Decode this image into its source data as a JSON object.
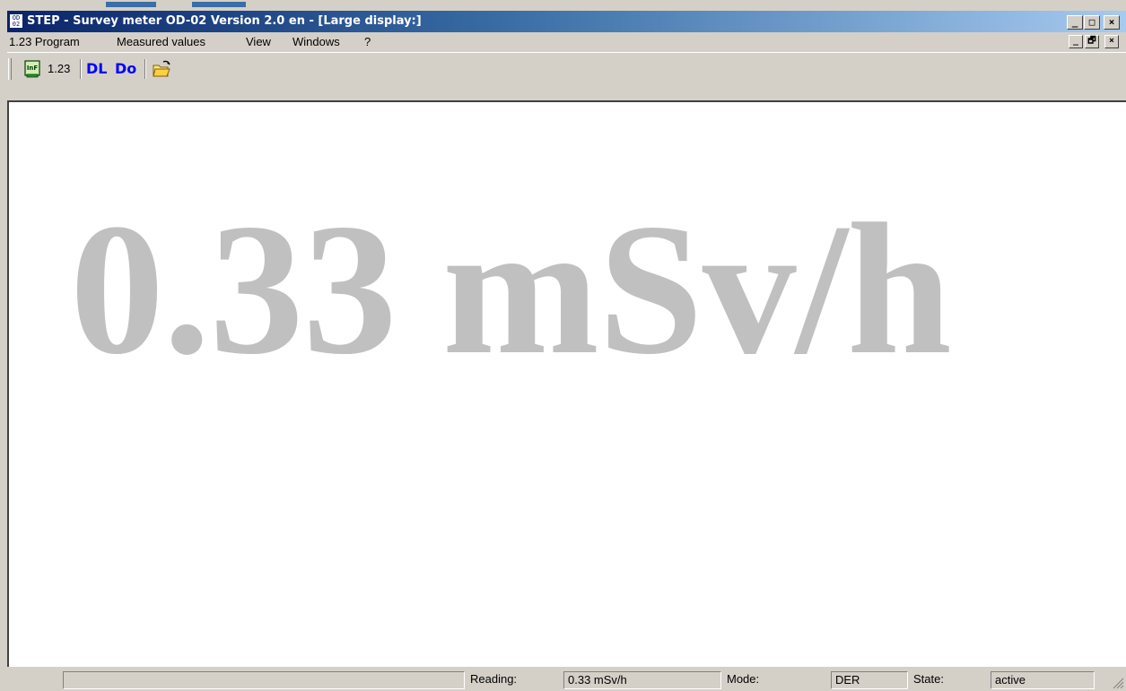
{
  "window": {
    "title": "STEP - Survey meter OD-02  Version 2.0 en - [Large display:]",
    "app_icon_text": "OD 02"
  },
  "caption_buttons": {
    "minimize": "_",
    "maximize": "□",
    "close": "×"
  },
  "menubar": {
    "items": [
      "1.23 Program",
      "Measured values",
      "View",
      "Windows",
      "?"
    ]
  },
  "mdi_buttons": {
    "minimize": "_",
    "restore": "🗗",
    "close": "×"
  },
  "toolbar": {
    "buttons": [
      {
        "icon": "info-icon",
        "label": "InF"
      },
      {
        "icon": "large-display-icon",
        "label": "1.23"
      },
      {
        "icon": "dl-icon",
        "label": "DL"
      },
      {
        "icon": "do-icon",
        "label": "Do"
      },
      {
        "icon": "open-folder-icon",
        "label": ""
      }
    ]
  },
  "display": {
    "reading": "0.33 mSv/h",
    "color": "#c0c0c0"
  },
  "statusbar": {
    "reading_label": "Reading:",
    "reading_value": "0.33 mSv/h",
    "mode_label": "Mode:",
    "mode_value": "DER",
    "state_label": "State:",
    "state_value": "active"
  },
  "colors": {
    "titlebar_start": "#0a246a",
    "titlebar_end": "#a6caf0",
    "chrome": "#d4d0c8",
    "dl_blue": "#0000ff"
  }
}
